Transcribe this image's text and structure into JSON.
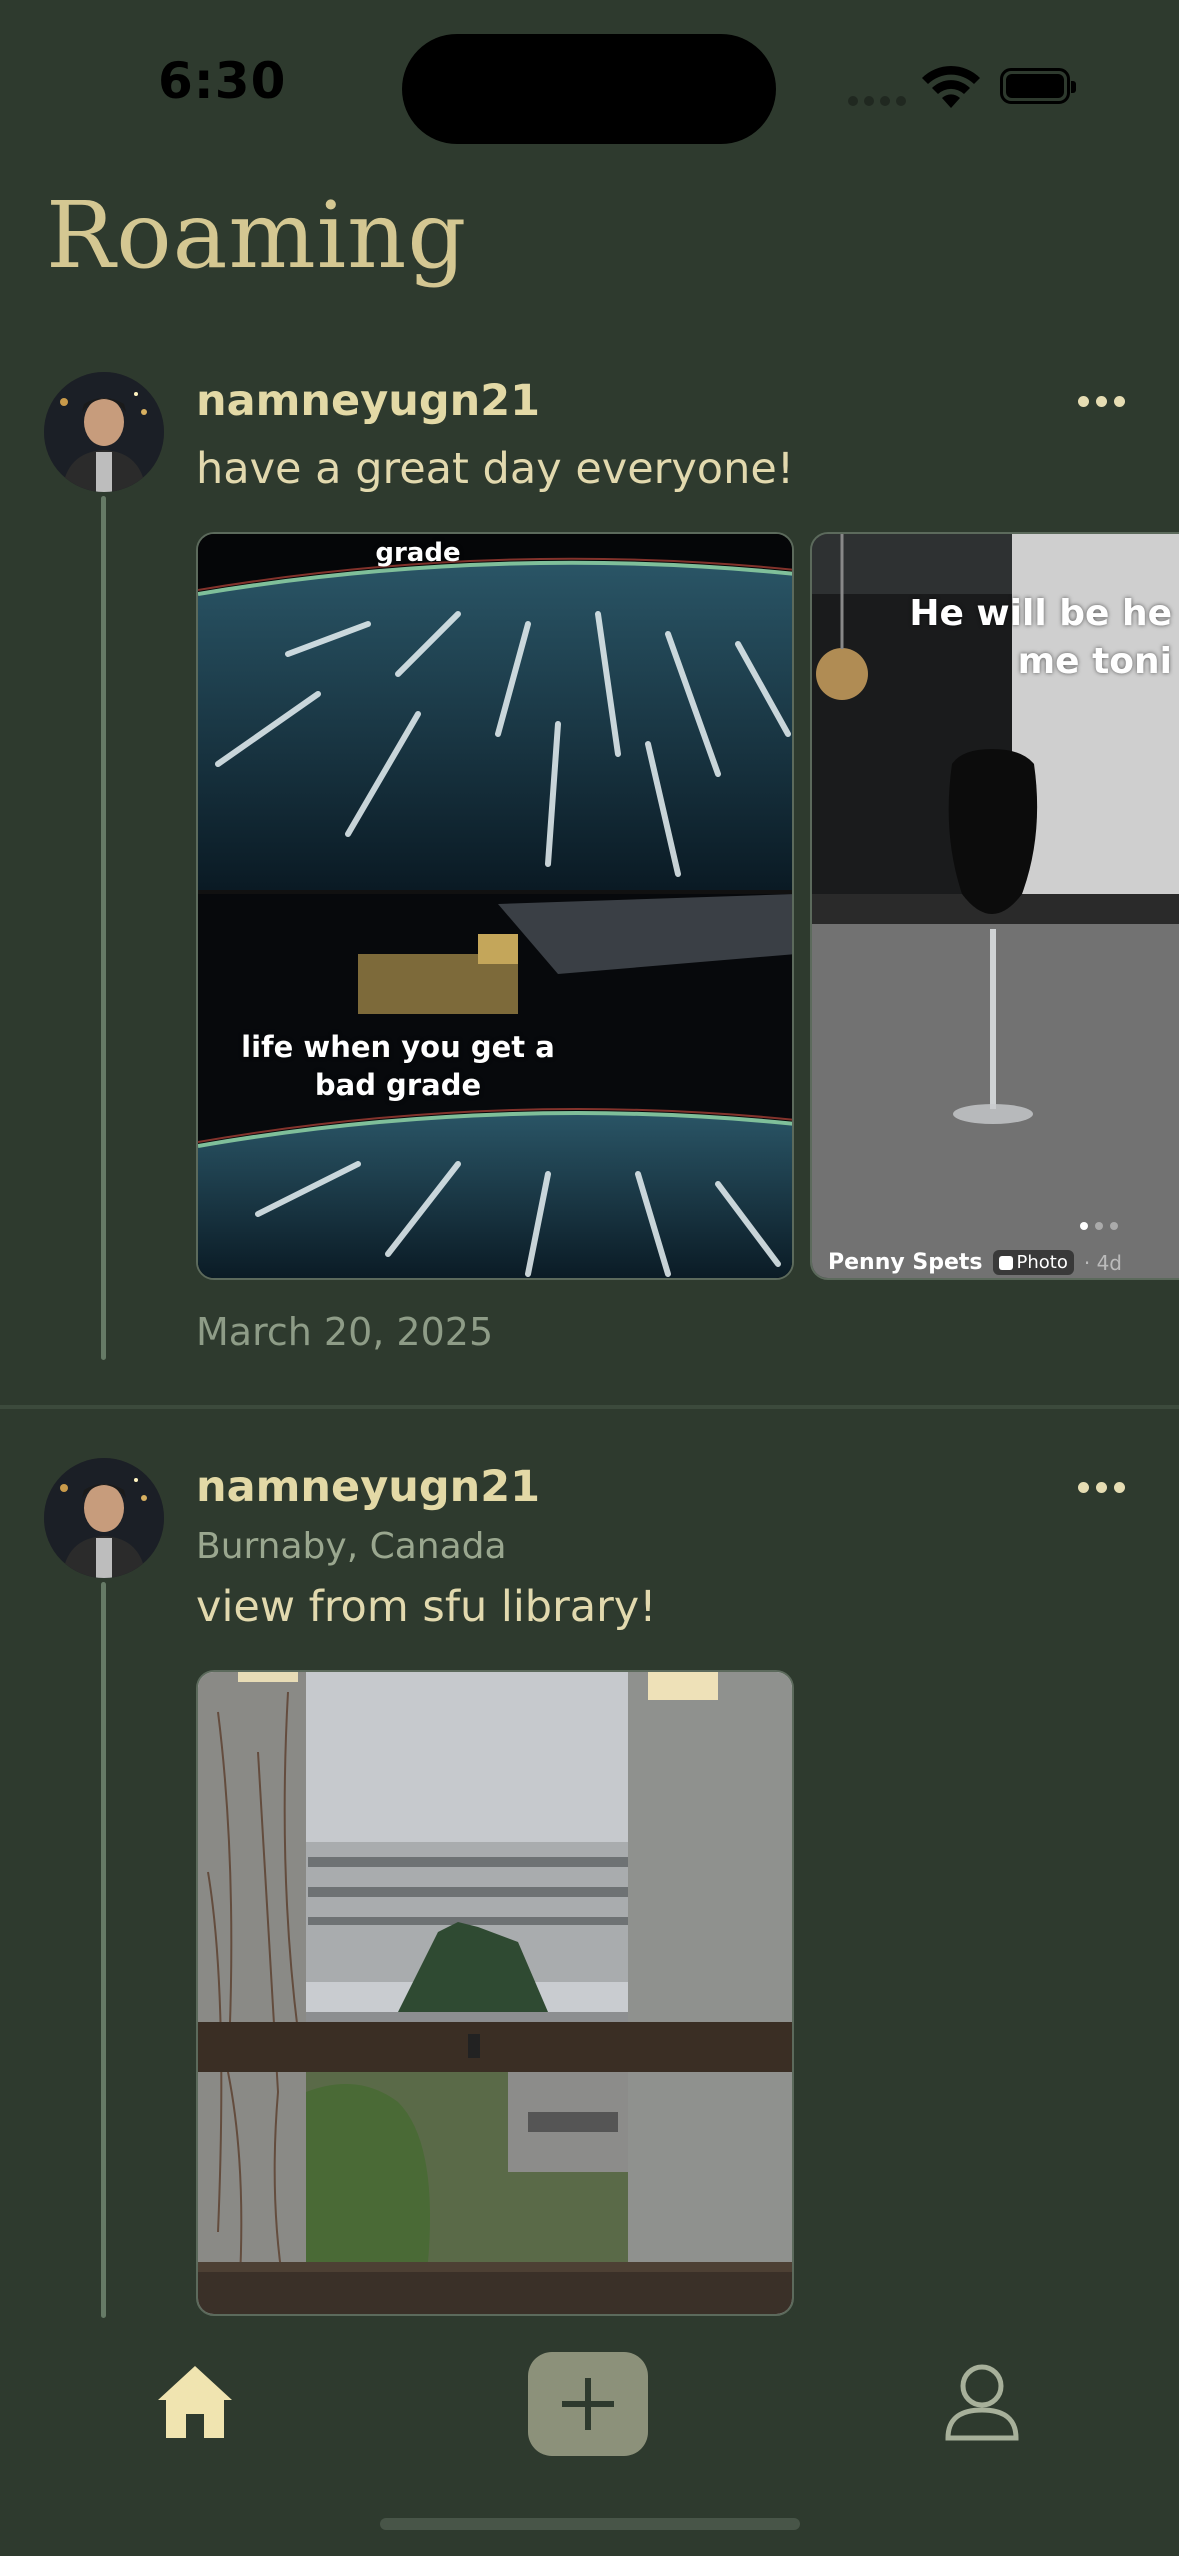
{
  "status_bar": {
    "time": "6:30"
  },
  "header": {
    "title": "Roaming"
  },
  "posts": [
    {
      "username": "namneyugn21",
      "location": "",
      "caption": "have a great day everyone!",
      "date": "March 20, 2025",
      "media": [
        {
          "kind": "meme",
          "top_text": "grade",
          "middle_text": "life when you get a bad grade"
        },
        {
          "kind": "screenshot",
          "overlay_text": "He will be he me toni",
          "author": "Penny Spets",
          "badge": "Photo",
          "age": "· 4d"
        }
      ]
    },
    {
      "username": "namneyugn21",
      "location": "Burnaby, Canada",
      "caption": "view from sfu library!",
      "date": "",
      "media": [
        {
          "kind": "photo"
        }
      ]
    }
  ],
  "tab_bar": {
    "items": [
      {
        "icon": "home-icon",
        "active": true
      },
      {
        "icon": "plus-icon"
      },
      {
        "icon": "person-icon"
      }
    ]
  },
  "colors": {
    "background": "#2e3a2e",
    "accent": "#d4c792",
    "muted": "#8e9c87"
  }
}
